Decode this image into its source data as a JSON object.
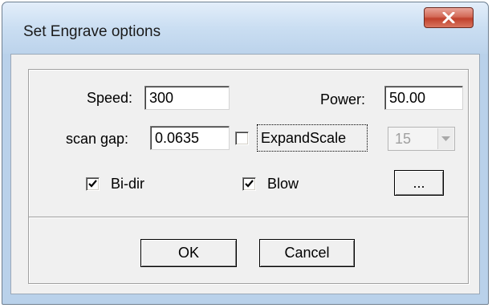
{
  "window": {
    "title": "Set Engrave options"
  },
  "fields": {
    "speed": {
      "label": "Speed:",
      "value": "300"
    },
    "power": {
      "label": "Power:",
      "value": "50.00"
    },
    "scan_gap": {
      "label": "scan gap:",
      "value": "0.0635"
    }
  },
  "checkboxes": {
    "expand_scale": {
      "label": "ExpandScale",
      "checked": false
    },
    "bi_dir": {
      "label": "Bi-dir",
      "checked": true
    },
    "blow": {
      "label": "Blow",
      "checked": true
    }
  },
  "expand_scale_combo": {
    "value": "15",
    "enabled": false
  },
  "buttons": {
    "more": "...",
    "ok": "OK",
    "cancel": "Cancel"
  },
  "icons": {
    "close": "close-icon",
    "check": "check-icon",
    "dropdown": "chevron-down-icon"
  }
}
